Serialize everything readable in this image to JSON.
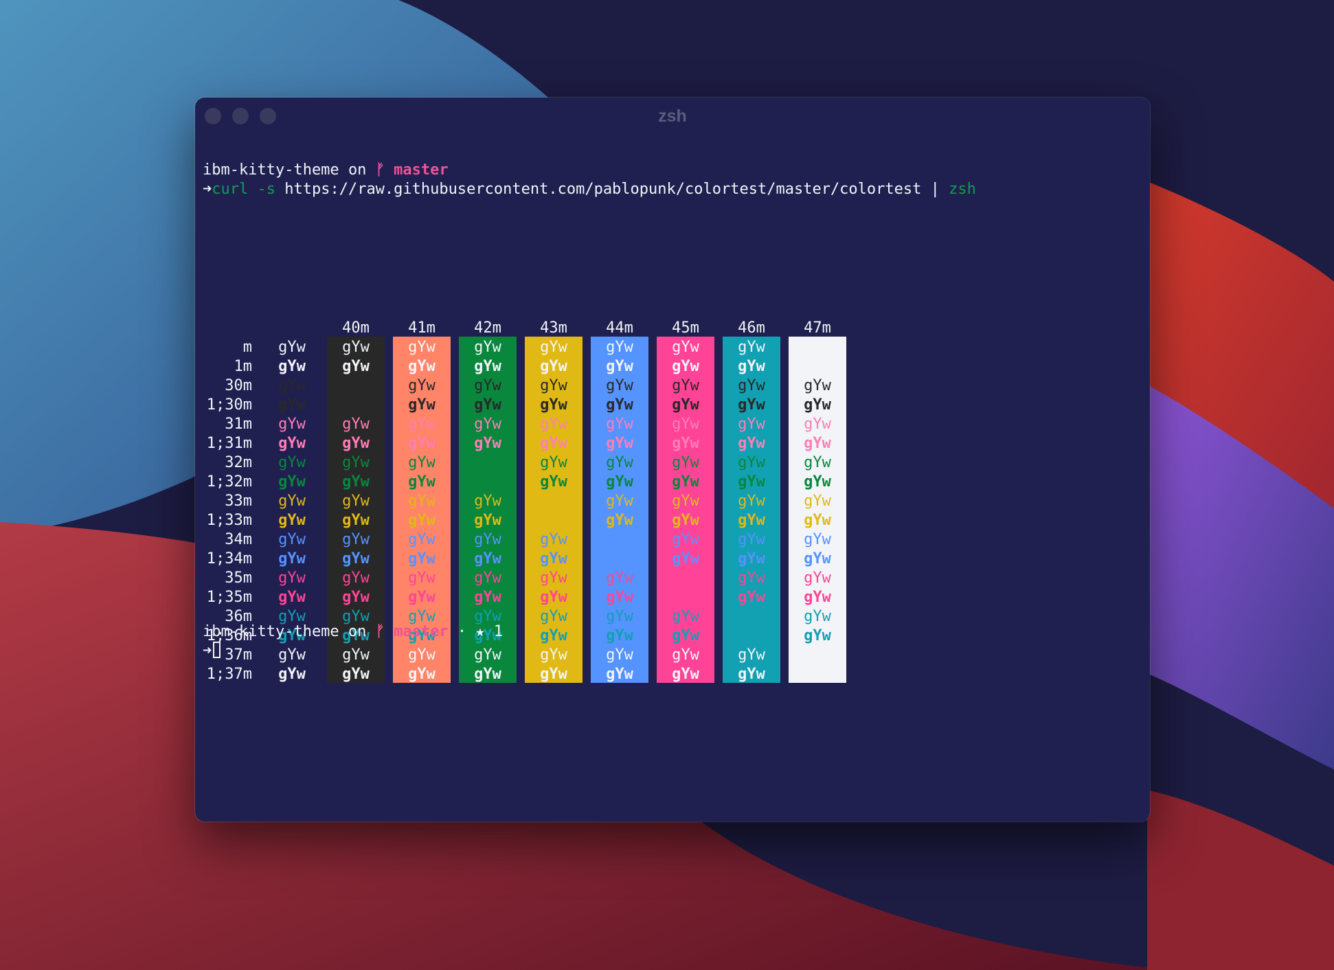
{
  "window": {
    "title": "zsh"
  },
  "prompt1": {
    "directory": "ibm-kitty-theme",
    "on_word": "on",
    "branch_icon": "git-branch-icon",
    "branch_glyph": "ᚠ",
    "branch": "master",
    "arrow": "➜",
    "cmd_name": "curl",
    "cmd_flag": "-s",
    "cmd_url": "https://raw.githubusercontent.com/pablopunk/colortest/master/colortest",
    "cmd_pipe": "|",
    "cmd_shell": "zsh"
  },
  "colortest": {
    "sample": "gYw",
    "bg_columns": [
      "40m",
      "41m",
      "42m",
      "43m",
      "44m",
      "45m",
      "46m",
      "47m"
    ],
    "rows": [
      "m",
      "1m",
      "30m",
      "1;30m",
      "31m",
      "1;31m",
      "32m",
      "1;32m",
      "33m",
      "1;33m",
      "34m",
      "1;34m",
      "35m",
      "1;35m",
      "36m",
      "1;36m",
      "37m",
      "1;37m"
    ]
  },
  "prompt2": {
    "directory": "ibm-kitty-theme",
    "on_word": "on",
    "branch_glyph": "ᚠ",
    "branch": "master",
    "status": "· ★ 1",
    "arrow": "➜"
  },
  "colors": {
    "default_fg": "#f2f4f8",
    "black": "#282828",
    "red": "#ff7eb6",
    "salmon": "#ff8468",
    "green": "#08873d",
    "yellow": "#e1b915",
    "blue": "#5593ff",
    "magenta": "#ff4497",
    "cyan": "#12a0b3",
    "white": "#f2f4f8",
    "background": "#202050",
    "prompt_branch": "#ee5396",
    "cmd_green": "#0e9e52"
  }
}
